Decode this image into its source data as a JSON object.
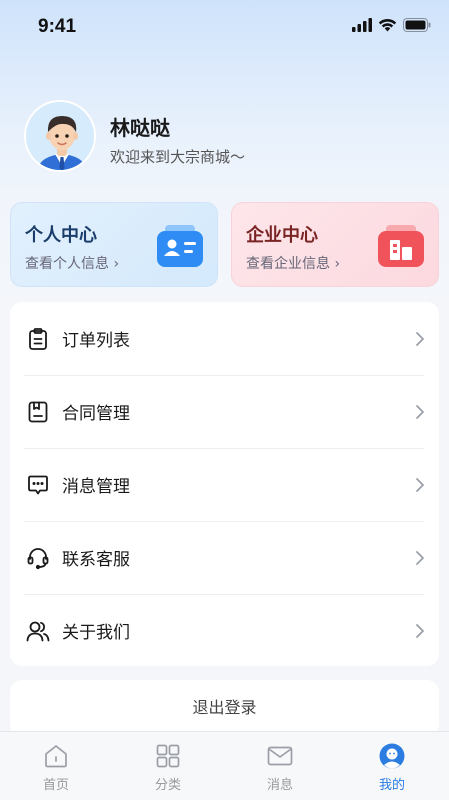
{
  "status_bar": {
    "time": "9:41"
  },
  "profile": {
    "name": "林哒哒",
    "welcome": "欢迎来到大宗商城～"
  },
  "cards": {
    "personal": {
      "title": "个人中心",
      "subtitle": "查看个人信息 ›",
      "icon": "id-card-icon",
      "color": "#2f8cf5"
    },
    "company": {
      "title": "企业中心",
      "subtitle": "查看企业信息 ›",
      "icon": "building-icon",
      "color": "#f0535a"
    }
  },
  "menu": {
    "items": [
      {
        "label": "订单列表",
        "icon": "clipboard-icon"
      },
      {
        "label": "合同管理",
        "icon": "contract-icon"
      },
      {
        "label": "消息管理",
        "icon": "message-icon"
      },
      {
        "label": "联系客服",
        "icon": "headset-icon"
      },
      {
        "label": "关于我们",
        "icon": "users-icon"
      }
    ]
  },
  "logout_label": "退出登录",
  "tab_bar": {
    "tabs": [
      {
        "label": "首页",
        "icon": "home-icon",
        "active": false
      },
      {
        "label": "分类",
        "icon": "grid-icon",
        "active": false
      },
      {
        "label": "消息",
        "icon": "mail-icon",
        "active": false
      },
      {
        "label": "我的",
        "icon": "profile-icon",
        "active": true
      }
    ],
    "active_color": "#2b7de0",
    "inactive_color": "#999999"
  }
}
